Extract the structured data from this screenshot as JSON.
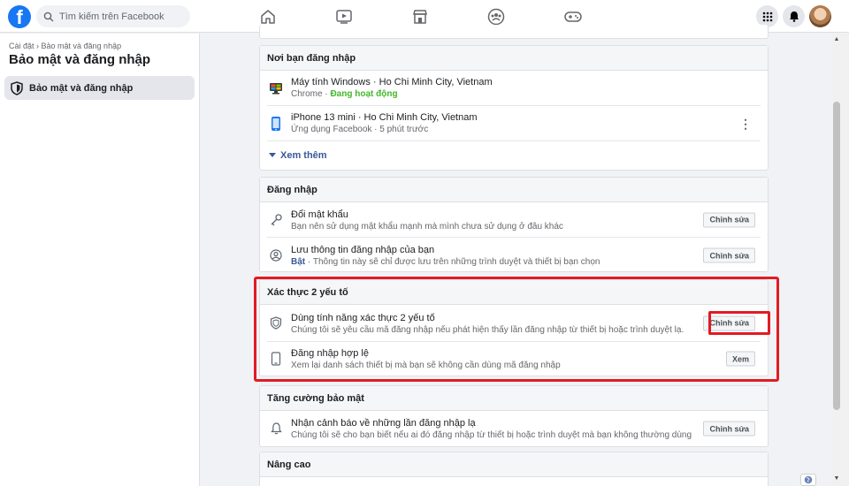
{
  "header": {
    "logo": "f",
    "search_placeholder": "Tìm kiếm trên Facebook",
    "nav_icons": [
      "home-icon",
      "watch-icon",
      "marketplace-icon",
      "groups-icon",
      "gaming-icon"
    ],
    "right_icons": [
      "menu-grid-icon",
      "messenger-icon",
      "avatar"
    ]
  },
  "sidebar": {
    "breadcrumb": "Cài đặt › Bảo mật và đăng nhập",
    "title": "Bảo mật và đăng nhập",
    "items": [
      {
        "label": "Bảo mật và đăng nhập",
        "icon": "shield-icon"
      }
    ]
  },
  "sections": {
    "login_locations": {
      "title": "Nơi bạn đăng nhập",
      "sessions": [
        {
          "device": "Máy tính Windows · Ho Chi Minh City, Vietnam",
          "app": "Chrome · ",
          "status": "Đang hoạt động",
          "icon": "desktop-icon"
        },
        {
          "device": "iPhone 13 mini · Ho Chi Minh City, Vietnam",
          "app": "Ứng dụng Facebook · 5 phút trước",
          "icon": "phone-icon"
        }
      ],
      "see_more": "Xem thêm"
    },
    "login": {
      "title": "Đăng nhập",
      "rows": [
        {
          "title": "Đổi mật khẩu",
          "desc": "Bạn nên sử dụng mật khẩu mạnh mà mình chưa sử dụng ở đâu khác",
          "button": "Chỉnh sửa",
          "icon": "key-icon"
        },
        {
          "title": "Lưu thông tin đăng nhập của bạn",
          "status": "Bật",
          "desc": " · Thông tin này sẽ chỉ được lưu trên những trình duyệt và thiết bị bạn chọn",
          "button": "Chỉnh sửa",
          "icon": "user-circle-icon"
        }
      ]
    },
    "two_factor": {
      "title": "Xác thực 2 yếu tố",
      "rows": [
        {
          "title": "Dùng tính năng xác thực 2 yếu tố",
          "desc": "Chúng tôi sẽ yêu cầu mã đăng nhập nếu phát hiện thấy lần đăng nhập từ thiết bị hoặc trình duyệt lạ.",
          "button": "Chỉnh sửa",
          "icon": "shield-icon"
        },
        {
          "title": "Đăng nhập hợp lệ",
          "desc": "Xem lại danh sách thiết bị mà bạn sẽ không cần dùng mã đăng nhập",
          "button": "Xem",
          "icon": "device-icon"
        }
      ]
    },
    "extra_security": {
      "title": "Tăng cường bảo mật",
      "rows": [
        {
          "title": "Nhận cảnh báo về những lần đăng nhập lạ",
          "desc": "Chúng tôi sẽ cho bạn biết nếu ai đó đăng nhập từ thiết bị hoặc trình duyệt mà bạn không thường dùng",
          "button": "Chỉnh sửa",
          "icon": "bell-icon"
        }
      ]
    },
    "advanced": {
      "title": "Nâng cao"
    }
  },
  "colors": {
    "brand": "#1877f2",
    "highlight": "#e21b22",
    "active_green": "#42b72a",
    "link_blue": "#385898"
  }
}
